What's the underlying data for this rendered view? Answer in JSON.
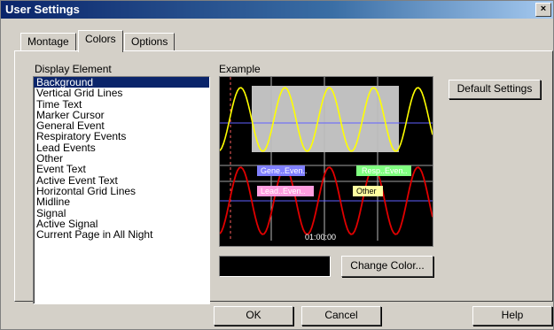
{
  "window": {
    "title": "User Settings",
    "close_glyph": "×"
  },
  "tabs": [
    {
      "label": "Montage",
      "active": false
    },
    {
      "label": "Colors",
      "active": true
    },
    {
      "label": "Options",
      "active": false
    }
  ],
  "display_element": {
    "label": "Display Element",
    "items": [
      "Background",
      "Vertical Grid Lines",
      "Time Text",
      "Marker Cursor",
      "General Event",
      "Respiratory Events",
      "Lead Events",
      "Other",
      "Event Text",
      "Active Event Text",
      "Horizontal Grid Lines",
      "Midline",
      "Signal",
      "Active Signal",
      "Current Page in All Night"
    ],
    "selected_index": 0
  },
  "example": {
    "label": "Example",
    "events": {
      "general": "Gene..Even..",
      "respiratory": "Resp..Even..",
      "lead": "Lead..Even..",
      "other": "Other"
    },
    "time_text": "01:00:00",
    "colors": {
      "background": "#000000",
      "signal": "#ffff00",
      "active_signal": "#e00000",
      "grid": "#c0c0c0",
      "midline": "#6060ff",
      "marker": "#ff6060",
      "general": "#8080ff",
      "respiratory": "#80ff80",
      "lead": "#ff9ee0",
      "other": "#ffffa0",
      "page_band": "#c0c0c0"
    }
  },
  "buttons": {
    "default_settings": "Default Settings",
    "change_color": "Change Color...",
    "ok": "OK",
    "cancel": "Cancel",
    "help": "Help"
  },
  "current_color": "#000000"
}
